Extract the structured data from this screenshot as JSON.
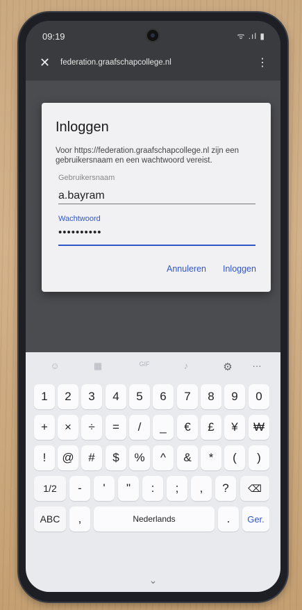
{
  "status_bar": {
    "time": "09:19",
    "icons": "ᯤ .ıl ▮"
  },
  "browser": {
    "url": "federation.graafschapcollege.nl",
    "close_icon": "✕",
    "menu_icon": "⋮"
  },
  "dialog": {
    "title": "Inloggen",
    "message": "Voor https://federation.graafschapcollege.nl zijn een gebruikersnaam en een wachtwoord vereist.",
    "username_label": "Gebruikersnaam",
    "username_value": "a.bayram",
    "password_label": "Wachtwoord",
    "password_value": "••••••••••",
    "cancel_label": "Annuleren",
    "login_label": "Inloggen"
  },
  "keyboard": {
    "toolbar": [
      "☺",
      "▦",
      "GIF",
      "♪",
      "⚙",
      "···"
    ],
    "row1": [
      "1",
      "2",
      "3",
      "4",
      "5",
      "6",
      "7",
      "8",
      "9",
      "0"
    ],
    "row2": [
      "+",
      "×",
      "÷",
      "=",
      "/",
      "_",
      "€",
      "£",
      "¥",
      "₩"
    ],
    "row3": [
      "!",
      "@",
      "#",
      "$",
      "%",
      "^",
      "&",
      "*",
      "(",
      ")"
    ],
    "row4": [
      "1/2",
      "-",
      "'",
      "\"",
      ":",
      ";",
      ",",
      "?",
      "⌫"
    ],
    "row5": [
      "ABC",
      ",",
      "Nederlands",
      ".",
      "Ger."
    ],
    "nav": "⌄"
  }
}
